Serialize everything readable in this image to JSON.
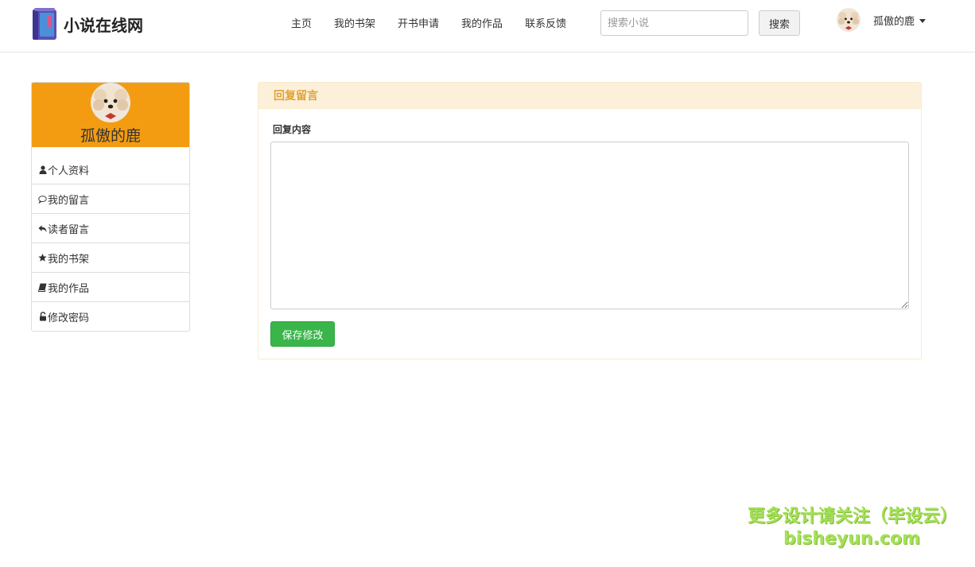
{
  "brand": {
    "name": "小说在线网",
    "icon": "book-icon",
    "colors": {
      "cover": "#5b4fb3",
      "spine": "#4a90d9",
      "ribbon": "#e84e8a"
    }
  },
  "nav": {
    "items": [
      {
        "label": "主页"
      },
      {
        "label": "我的书架"
      },
      {
        "label": "开书申请"
      },
      {
        "label": "我的作品"
      },
      {
        "label": "联系反馈"
      }
    ]
  },
  "search": {
    "placeholder": "搜索小说",
    "value": "",
    "button_label": "搜索"
  },
  "user": {
    "name": "孤傲的鹿",
    "avatar": "dog-avatar"
  },
  "sidebar": {
    "header_color": "#f39c12",
    "profile_name": "孤傲的鹿",
    "items": [
      {
        "label": "个人资料",
        "icon": "user-icon"
      },
      {
        "label": "我的留言",
        "icon": "comment-icon"
      },
      {
        "label": "读者留言",
        "icon": "reply-icon"
      },
      {
        "label": "我的书架",
        "icon": "star-icon"
      },
      {
        "label": "我的作品",
        "icon": "book-icon"
      },
      {
        "label": "修改密码",
        "icon": "lock-icon"
      }
    ]
  },
  "panel": {
    "title": "回复留言",
    "field_label": "回复内容",
    "textarea_value": "",
    "save_label": "保存修改",
    "colors": {
      "heading_bg": "#fcf0db",
      "heading_text": "#e0a336",
      "save_bg": "#39b54a"
    }
  },
  "watermark": {
    "line1": "更多设计请关注（毕设云）",
    "line2": "bisheyun.com"
  }
}
